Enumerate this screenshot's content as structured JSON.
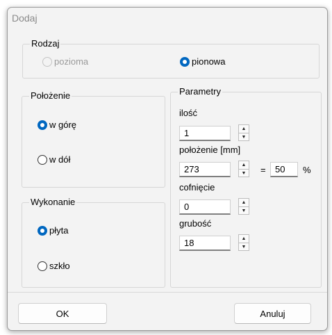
{
  "dialog": {
    "title": "Dodaj"
  },
  "rodzaj": {
    "label": "Rodzaj",
    "options": [
      {
        "label": "pozioma",
        "state": "disabled"
      },
      {
        "label": "pionowa",
        "state": "selected"
      }
    ]
  },
  "polozenie": {
    "label": "Położenie",
    "options": [
      {
        "label": "w górę",
        "state": "selected"
      },
      {
        "label": "w dół",
        "state": "unselected"
      }
    ]
  },
  "wykonanie": {
    "label": "Wykonanie",
    "options": [
      {
        "label": "płyta",
        "state": "selected"
      },
      {
        "label": "szkło",
        "state": "unselected"
      }
    ]
  },
  "parametry": {
    "label": "Parametry",
    "ilosc": {
      "label": "ilość",
      "value": "1"
    },
    "polozenie_mm": {
      "label": "położenie [mm]",
      "value": "273",
      "equals": "=",
      "percent_value": "50",
      "percent_sign": "%"
    },
    "cofniecie": {
      "label": "cofnięcie",
      "value": "0"
    },
    "grubosc": {
      "label": "grubość",
      "value": "18"
    }
  },
  "buttons": {
    "ok": "OK",
    "cancel": "Anuluj"
  },
  "colors": {
    "accent": "#0067c0",
    "dialog_bg": "#f3f3f3"
  },
  "icons": {
    "spin_up": "▲",
    "spin_down": "▼"
  }
}
